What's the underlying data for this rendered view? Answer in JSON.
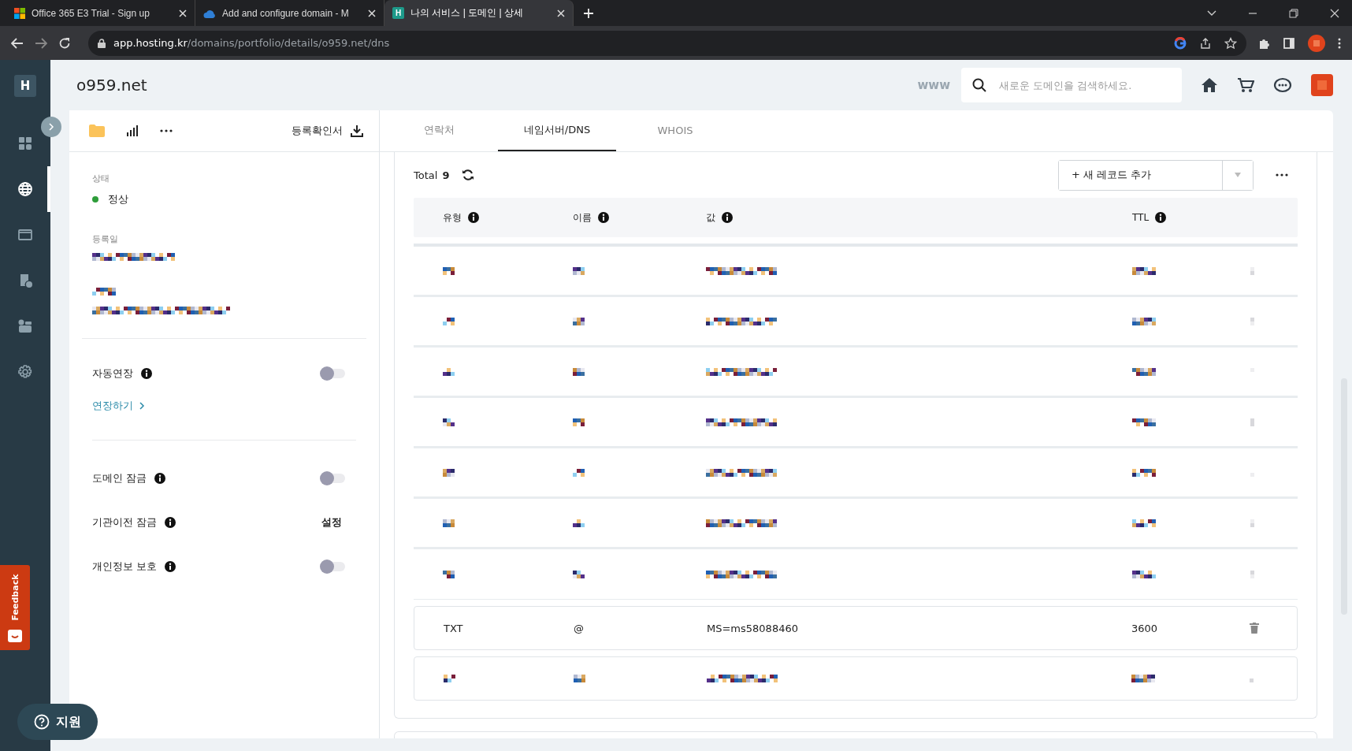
{
  "browser": {
    "tabs": [
      {
        "title": "Office 365 E3 Trial - Sign up",
        "selected": false
      },
      {
        "title": "Add and configure domain - M",
        "selected": false
      },
      {
        "title": "나의 서비스 | 도메인 | 상세",
        "favicon_text": "H",
        "selected": true
      }
    ],
    "address": {
      "host": "app.hosting.kr",
      "path": "/domains/portfolio/details/o959.net/dns"
    }
  },
  "sidebar": {
    "logo": "H",
    "items": [
      {
        "selected": false
      },
      {
        "selected": true
      },
      {
        "selected": false
      },
      {
        "selected": false
      },
      {
        "selected": false
      },
      {
        "selected": false
      }
    ],
    "feedback": "Feedback",
    "support": "지원"
  },
  "header": {
    "domain": "o959.net",
    "www": "www",
    "search": {
      "placeholder": "새로운 도메인을 검색하세요."
    }
  },
  "info_panel": {
    "certificate": "등록확인서",
    "fields": [
      {
        "label": "상태",
        "kind": "status",
        "value": "정상",
        "color": "#2e9d3a"
      },
      {
        "label": "등록일",
        "kind": "masked"
      },
      {
        "kind": "masked_pair"
      }
    ],
    "settings": [
      {
        "label": "자동연장",
        "kind": "toggle",
        "on": false,
        "link": "연장하기"
      },
      {
        "label": "도메인 잠금",
        "kind": "toggle",
        "on": false
      },
      {
        "label": "기관이전 잠금",
        "kind": "action",
        "action": "설정"
      },
      {
        "label": "개인정보 보호",
        "kind": "toggle",
        "on": false
      }
    ]
  },
  "tabs": [
    {
      "label": "연락처",
      "selected": false
    },
    {
      "label": "네임서버/DNS",
      "selected": true
    },
    {
      "label": "WHOIS",
      "selected": false
    }
  ],
  "dns": {
    "total_label": "Total",
    "total": "9",
    "add_button": "+ 새 레코드 추가",
    "columns": [
      "유형",
      "이름",
      "값",
      "TTL"
    ],
    "rows": [
      {
        "kind": "masked"
      },
      {
        "kind": "masked"
      },
      {
        "kind": "masked"
      },
      {
        "kind": "masked"
      },
      {
        "kind": "masked"
      },
      {
        "kind": "masked"
      },
      {
        "kind": "masked"
      },
      {
        "kind": "record",
        "type": "TXT",
        "name": "@",
        "value": "MS=ms58088460",
        "ttl": "3600"
      },
      {
        "kind": "masked_card"
      }
    ]
  }
}
